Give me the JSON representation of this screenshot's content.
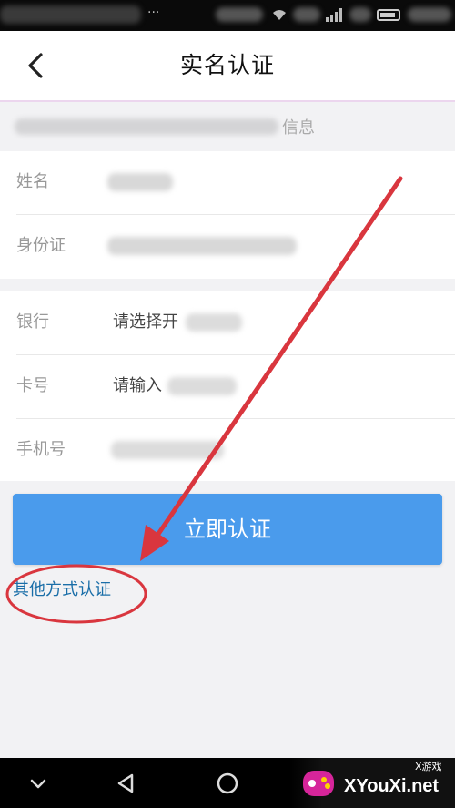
{
  "status_bar": {
    "dots": "···"
  },
  "header": {
    "title": "实名认证"
  },
  "notice": {
    "text_visible_tail": "信息"
  },
  "identity": {
    "name_label": "姓名",
    "id_label": "身份证"
  },
  "bank": {
    "bank_label": "银行",
    "bank_placeholder": "请选择开",
    "card_label": "卡号",
    "card_placeholder": "请输入",
    "phone_label": "手机号"
  },
  "actions": {
    "submit_label": "立即认证",
    "other_method_label": "其他方式认证"
  },
  "watermark": {
    "site_name": "XYouXi.net",
    "sub_label": "X游戏"
  },
  "colors": {
    "primary_button": "#4a9bec",
    "link": "#1a6ea8",
    "annotation_red": "#d9363e"
  }
}
